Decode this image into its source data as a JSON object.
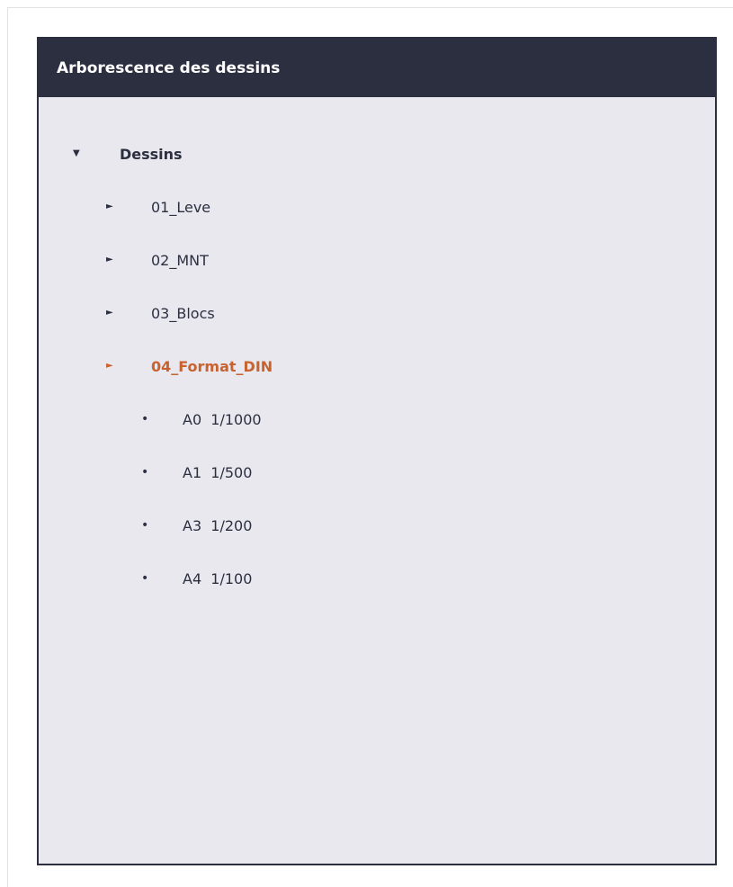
{
  "panel": {
    "title": "Arborescence des dessins"
  },
  "tree": {
    "root": {
      "label": "Dessins",
      "toggle": "▼"
    },
    "folders": [
      {
        "label": "01_Leve",
        "toggle": "►"
      },
      {
        "label": "02_MNT",
        "toggle": "►"
      },
      {
        "label": "03_Blocs",
        "toggle": "►"
      },
      {
        "label": "04_Format_DIN",
        "toggle": "►"
      }
    ],
    "leaves": [
      {
        "label": "A0  1/1000",
        "bullet": "•"
      },
      {
        "label": "A1  1/500",
        "bullet": "•"
      },
      {
        "label": "A3  1/200",
        "bullet": "•"
      },
      {
        "label": "A4  1/100",
        "bullet": "•"
      }
    ]
  },
  "colors": {
    "header_bg": "#2b2f40",
    "panel_bg": "#e8e8ee",
    "accent": "#c8622e"
  }
}
